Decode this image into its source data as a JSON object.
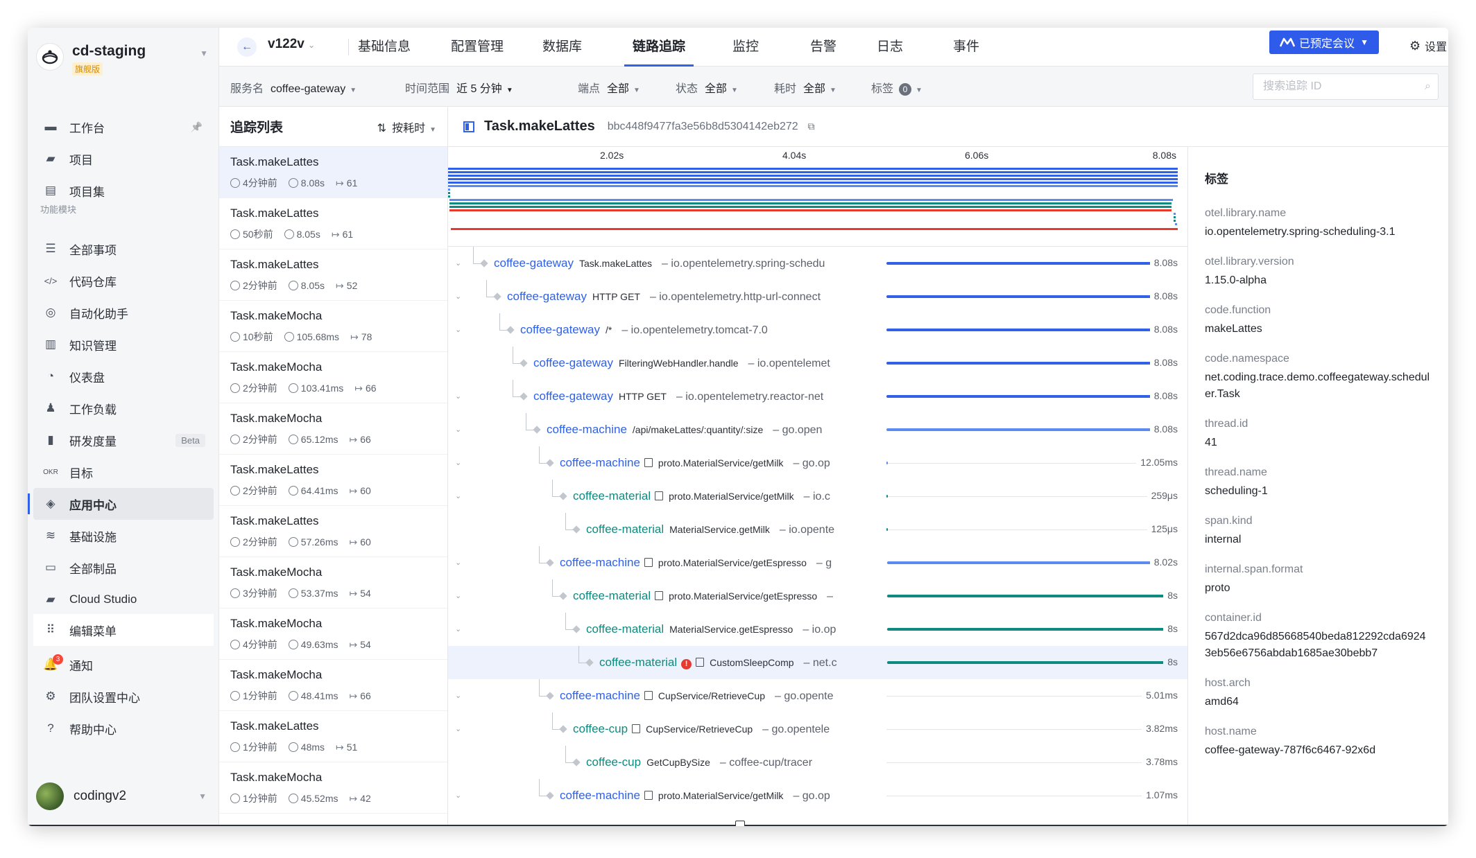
{
  "project": {
    "name": "cd-staging",
    "badge": "旗舰版"
  },
  "sidebar": {
    "section_label": "功能模块",
    "items": [
      {
        "label": "工作台",
        "icon": "monitor-icon"
      },
      {
        "label": "项目",
        "icon": "folder-icon"
      },
      {
        "label": "项目集",
        "icon": "project-set-icon"
      },
      {
        "label": "全部事项",
        "icon": "list-icon"
      },
      {
        "label": "代码仓库",
        "icon": "code-icon"
      },
      {
        "label": "自动化助手",
        "icon": "robot-icon"
      },
      {
        "label": "知识管理",
        "icon": "book-icon"
      },
      {
        "label": "仪表盘",
        "icon": "dashboard-icon"
      },
      {
        "label": "工作负载",
        "icon": "workload-icon"
      },
      {
        "label": "研发度量",
        "icon": "bar-chart-icon",
        "badge": "Beta"
      },
      {
        "label": "目标",
        "icon": "okr-icon"
      },
      {
        "label": "应用中心",
        "icon": "cube-icon"
      },
      {
        "label": "基础设施",
        "icon": "database-icon"
      },
      {
        "label": "全部制品",
        "icon": "artifact-icon"
      },
      {
        "label": "Cloud Studio",
        "icon": "cloud-studio-icon"
      },
      {
        "label": "编辑菜单",
        "icon": "grid-icon"
      }
    ],
    "bottom": [
      {
        "label": "通知",
        "icon": "bell-icon",
        "count": "3"
      },
      {
        "label": "团队设置中心",
        "icon": "gear-icon"
      },
      {
        "label": "帮助中心",
        "icon": "help-icon"
      }
    ],
    "user": "codingv2"
  },
  "topbar": {
    "version": "v122v",
    "tabs": [
      "基础信息",
      "配置管理",
      "数据库",
      "链路追踪",
      "监控",
      "告警",
      "日志",
      "事件"
    ],
    "meeting": "已预定会议",
    "settings": "设置"
  },
  "filters": {
    "service_label": "服务名",
    "service_value": "coffee-gateway",
    "range_label": "时间范围",
    "range_value": "近 5 分钟",
    "endpoint_label": "端点",
    "endpoint_value": "全部",
    "status_label": "状态",
    "status_value": "全部",
    "duration_label": "耗时",
    "duration_value": "全部",
    "tags_label": "标签",
    "tags_count": "0",
    "search_placeholder": "搜索追踪 ID"
  },
  "trace_list": {
    "title": "追踪列表",
    "sort": "按耗时",
    "items": [
      {
        "name": "Task.makeLattes",
        "time": "4分钟前",
        "dur": "8.08s",
        "spans": "61"
      },
      {
        "name": "Task.makeLattes",
        "time": "50秒前",
        "dur": "8.05s",
        "spans": "61"
      },
      {
        "name": "Task.makeLattes",
        "time": "2分钟前",
        "dur": "8.05s",
        "spans": "52"
      },
      {
        "name": "Task.makeMocha",
        "time": "10秒前",
        "dur": "105.68ms",
        "spans": "78"
      },
      {
        "name": "Task.makeMocha",
        "time": "2分钟前",
        "dur": "103.41ms",
        "spans": "66"
      },
      {
        "name": "Task.makeMocha",
        "time": "2分钟前",
        "dur": "65.12ms",
        "spans": "66"
      },
      {
        "name": "Task.makeLattes",
        "time": "2分钟前",
        "dur": "64.41ms",
        "spans": "60"
      },
      {
        "name": "Task.makeLattes",
        "time": "2分钟前",
        "dur": "57.26ms",
        "spans": "60"
      },
      {
        "name": "Task.makeMocha",
        "time": "3分钟前",
        "dur": "53.37ms",
        "spans": "54"
      },
      {
        "name": "Task.makeMocha",
        "time": "4分钟前",
        "dur": "49.63ms",
        "spans": "54"
      },
      {
        "name": "Task.makeMocha",
        "time": "1分钟前",
        "dur": "48.41ms",
        "spans": "66"
      },
      {
        "name": "Task.makeLattes",
        "time": "1分钟前",
        "dur": "48ms",
        "spans": "51"
      },
      {
        "name": "Task.makeMocha",
        "time": "1分钟前",
        "dur": "45.52ms",
        "spans": "42"
      }
    ]
  },
  "trace": {
    "title": "Task.makeLattes",
    "id": "bbc448f9477fa3e56b8d5304142eb272",
    "ticks": [
      "2.02s",
      "4.04s",
      "6.06s",
      "8.08s"
    ],
    "spans": [
      {
        "svc": "coffee-gateway",
        "op": "Task.makeLattes",
        "lib": "– io.opentelemetry.spring-schedu",
        "dur": "8.08s",
        "depth": 0,
        "color": "#3061e6",
        "start": 0,
        "frac": 1.0,
        "toggle": true,
        "doc": false
      },
      {
        "svc": "coffee-gateway",
        "op": "HTTP GET",
        "lib": "– io.opentelemetry.http-url-connect",
        "dur": "8.08s",
        "depth": 1,
        "color": "#3061e6",
        "start": 0,
        "frac": 1.0,
        "toggle": true,
        "doc": false
      },
      {
        "svc": "coffee-gateway",
        "op": "/*",
        "lib": "– io.opentelemetry.tomcat-7.0",
        "dur": "8.08s",
        "depth": 2,
        "color": "#3061e6",
        "start": 0,
        "frac": 1.0,
        "toggle": true,
        "doc": false
      },
      {
        "svc": "coffee-gateway",
        "op": "FilteringWebHandler.handle",
        "lib": "– io.opentelemet",
        "dur": "8.08s",
        "depth": 3,
        "color": "#3061e6",
        "start": 0,
        "frac": 1.0,
        "toggle": false,
        "doc": false
      },
      {
        "svc": "coffee-gateway",
        "op": "HTTP GET",
        "lib": "– io.opentelemetry.reactor-net",
        "dur": "8.08s",
        "depth": 3,
        "color": "#3061e6",
        "start": 0,
        "frac": 1.0,
        "toggle": true,
        "doc": false
      },
      {
        "svc": "coffee-machine",
        "op": "/api/makeLattes/:quantity/:size",
        "lib": "– go.open",
        "dur": "8.08s",
        "depth": 4,
        "color": "#5b8af0",
        "start": 0,
        "frac": 1.0,
        "toggle": true,
        "doc": false
      },
      {
        "svc": "coffee-machine",
        "op": "proto.MaterialService/getMilk",
        "lib": "– go.op",
        "dur": "12.05ms",
        "depth": 5,
        "color": "#5b8af0",
        "start": 0,
        "frac": 0.0015,
        "toggle": true,
        "doc": true
      },
      {
        "svc": "coffee-material",
        "op": "proto.MaterialService/getMilk",
        "lib": "– io.c",
        "dur": "259μs",
        "depth": 6,
        "color": "#0f8a7e",
        "start": 0,
        "frac": 0.0003,
        "toggle": true,
        "doc": true
      },
      {
        "svc": "coffee-material",
        "op": "MaterialService.getMilk",
        "lib": "– io.opente",
        "dur": "125μs",
        "depth": 7,
        "color": "#0f8a7e",
        "start": 0,
        "frac": 0.0002,
        "toggle": false,
        "doc": false
      },
      {
        "svc": "coffee-machine",
        "op": "proto.MaterialService/getEspresso",
        "lib": "– g",
        "dur": "8.02s",
        "depth": 5,
        "color": "#5b8af0",
        "start": 0.0015,
        "frac": 0.992,
        "toggle": true,
        "doc": true
      },
      {
        "svc": "coffee-material",
        "op": "proto.MaterialService/getEspresso",
        "lib": "–",
        "dur": "8s",
        "depth": 6,
        "color": "#0f8a7e",
        "start": 0.0015,
        "frac": 0.99,
        "toggle": true,
        "doc": true
      },
      {
        "svc": "coffee-material",
        "op": "MaterialService.getEspresso",
        "lib": "– io.op",
        "dur": "8s",
        "depth": 7,
        "color": "#0f8a7e",
        "start": 0.0015,
        "frac": 0.99,
        "toggle": true,
        "doc": false
      },
      {
        "svc": "coffee-material",
        "op": "CustomSleepComp",
        "lib": "– net.c",
        "dur": "8s",
        "depth": 8,
        "color": "#0f8a7e",
        "start": 0.0015,
        "frac": 0.99,
        "toggle": false,
        "doc": true,
        "error": true,
        "highlight": true
      },
      {
        "svc": "coffee-machine",
        "op": "CupService/RetrieveCup",
        "lib": "– go.opente",
        "dur": "5.01ms",
        "depth": 5,
        "color": "#5b8af0",
        "start": 0.994,
        "frac": 0.001,
        "toggle": true,
        "doc": true
      },
      {
        "svc": "coffee-cup",
        "op": "CupService/RetrieveCup",
        "lib": "– go.opentele",
        "dur": "3.82ms",
        "depth": 6,
        "color": "#0f8a7e",
        "start": 0.994,
        "frac": 0.0008,
        "toggle": true,
        "doc": true
      },
      {
        "svc": "coffee-cup",
        "op": "GetCupBySize",
        "lib": "– coffee-cup/tracer",
        "dur": "3.78ms",
        "depth": 7,
        "color": "#0f8a7e",
        "start": 0.994,
        "frac": 0.0008,
        "toggle": false,
        "doc": false
      },
      {
        "svc": "coffee-machine",
        "op": "proto.MaterialService/getMilk",
        "lib": "– go.op",
        "dur": "1.07ms",
        "depth": 5,
        "color": "#5b8af0",
        "start": 0.996,
        "frac": 0.0002,
        "toggle": true,
        "doc": true
      }
    ]
  },
  "tags": {
    "title": "标签",
    "items": [
      {
        "k": "otel.library.name",
        "v": "io.opentelemetry.spring-scheduling-3.1"
      },
      {
        "k": "otel.library.version",
        "v": "1.15.0-alpha"
      },
      {
        "k": "code.function",
        "v": "makeLattes"
      },
      {
        "k": "code.namespace",
        "v": "net.coding.trace.demo.coffeegateway.scheduler.Task"
      },
      {
        "k": "thread.id",
        "v": "41"
      },
      {
        "k": "thread.name",
        "v": "scheduling-1"
      },
      {
        "k": "span.kind",
        "v": "internal"
      },
      {
        "k": "internal.span.format",
        "v": "proto"
      },
      {
        "k": "container.id",
        "v": "567d2dca96d85668540beda812292cda69243eb56e6756abdab1685ae30bebb7"
      },
      {
        "k": "host.arch",
        "v": "amd64"
      },
      {
        "k": "host.name",
        "v": "coffee-gateway-787f6c6467-92x6d"
      }
    ]
  }
}
